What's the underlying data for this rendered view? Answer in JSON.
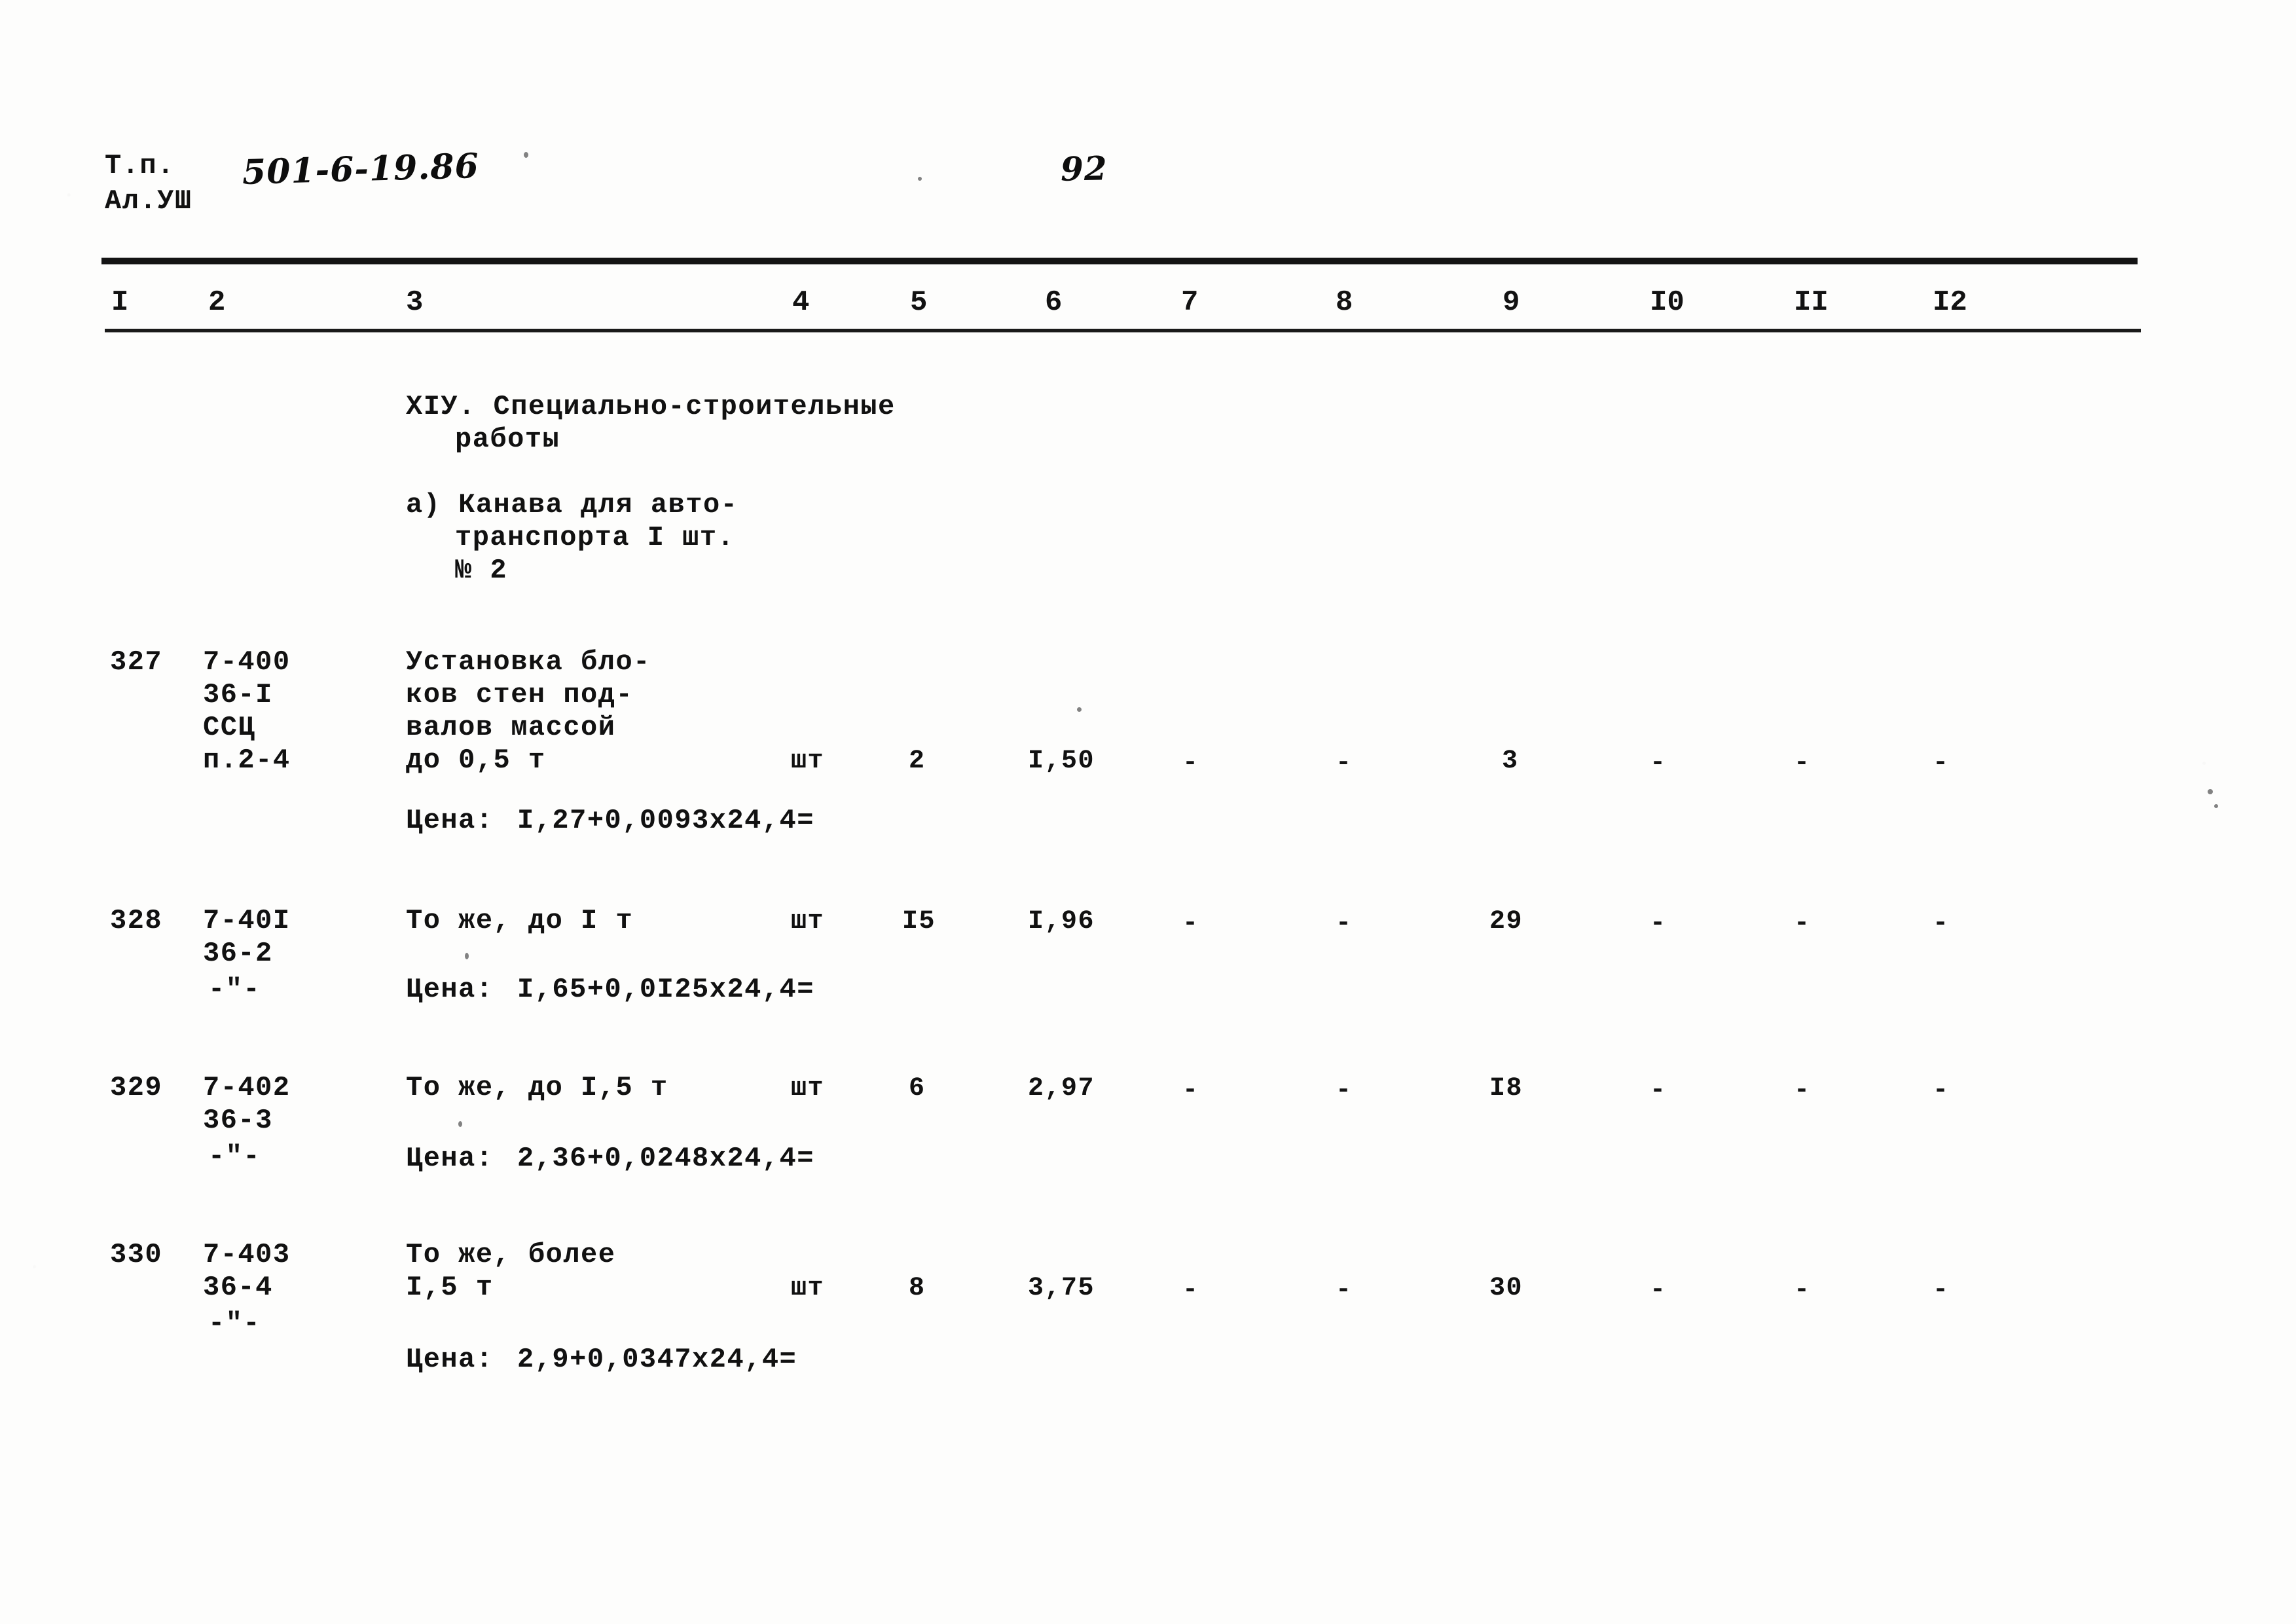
{
  "header": {
    "doc_label_line1": "Т.п.",
    "doc_label_line2": "Ал.УШ",
    "doc_code": "501-6-19.86",
    "page_number": "92"
  },
  "table": {
    "column_numbers": [
      "I",
      "2",
      "3",
      "4",
      "5",
      "6",
      "7",
      "8",
      "9",
      "I0",
      "II",
      "I2"
    ],
    "section_title_line1": "XIУ. Специально-строительные",
    "section_title_line2": "работы",
    "subsection": {
      "line1": "а) Канава для авто-",
      "line2": "транспорта I шт.",
      "line3": "№ 2"
    },
    "rows": [
      {
        "num": "327",
        "code_lines": [
          "7-400",
          "36-I",
          "ССЦ",
          "п.2-4"
        ],
        "desc_lines": [
          "Установка бло-",
          "ков стен под-",
          "валов массой",
          "до 0,5 т"
        ],
        "unit": "шт",
        "qty": "2",
        "col6": "I,50",
        "col7": "-",
        "col8": "-",
        "col9": "3",
        "col10": "-",
        "col11": "-",
        "col12": "-",
        "price_label": "Цена:",
        "price_formula": "I,27+0,0093х24,4="
      },
      {
        "num": "328",
        "code_lines": [
          "7-40I",
          "36-2",
          "-\"-"
        ],
        "desc_lines": [
          "То же, до I т"
        ],
        "unit": "шт",
        "qty": "I5",
        "col6": "I,96",
        "col7": "-",
        "col8": "-",
        "col9": "29",
        "col10": "-",
        "col11": "-",
        "col12": "-",
        "price_label": "Цена:",
        "price_formula": "I,65+0,0I25х24,4="
      },
      {
        "num": "329",
        "code_lines": [
          "7-402",
          "36-3",
          "-\"-"
        ],
        "desc_lines": [
          "То же, до I,5 т"
        ],
        "unit": "шт",
        "qty": "6",
        "col6": "2,97",
        "col7": "-",
        "col8": "-",
        "col9": "I8",
        "col10": "-",
        "col11": "-",
        "col12": "-",
        "price_label": "Цена:",
        "price_formula": "2,36+0,0248х24,4="
      },
      {
        "num": "330",
        "code_lines": [
          "7-403",
          "36-4",
          "-\"-"
        ],
        "desc_lines": [
          "То же, более",
          "I,5 т"
        ],
        "unit": "шт",
        "qty": "8",
        "col6": "3,75",
        "col7": "-",
        "col8": "-",
        "col9": "30",
        "col10": "-",
        "col11": "-",
        "col12": "-",
        "price_label": "Цена:",
        "price_formula": "2,9+0,0347х24,4="
      }
    ]
  }
}
